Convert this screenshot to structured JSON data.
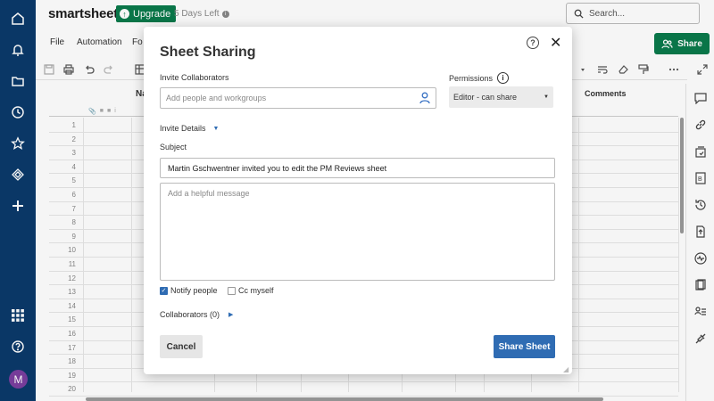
{
  "header": {
    "logo": "smartsheet",
    "upgrade_label": "Upgrade",
    "days_left": "5 Days Left",
    "search_placeholder": "Search..."
  },
  "menu": {
    "items": [
      "File",
      "Automation",
      "Fo"
    ],
    "share_label": "Share"
  },
  "grid": {
    "column_name_header": "Na",
    "comments_header": "Comments",
    "row_numbers": [
      "1",
      "2",
      "3",
      "4",
      "5",
      "6",
      "7",
      "8",
      "9",
      "10",
      "11",
      "12",
      "13",
      "14",
      "15",
      "16",
      "17",
      "18",
      "19",
      "20"
    ]
  },
  "dialog": {
    "title": "Sheet Sharing",
    "invite_label": "Invite Collaborators",
    "invite_placeholder": "Add people and workgroups",
    "permissions_label": "Permissions",
    "permission_value": "Editor - can share",
    "invite_details_label": "Invite Details",
    "subject_label": "Subject",
    "subject_value": "Martin Gschwentner invited you to edit the PM Reviews sheet",
    "message_placeholder": "Add a helpful message",
    "notify_label": "Notify people",
    "notify_checked": true,
    "cc_label": "Cc myself",
    "cc_checked": false,
    "collaborators_label": "Collaborators (0)",
    "cancel_label": "Cancel",
    "share_label": "Share Sheet"
  },
  "user": {
    "avatar_initial": "M"
  },
  "colors": {
    "nav_bg": "#0b3a6b",
    "brand_green": "#0a7a4b",
    "primary_blue": "#2f6cb3",
    "avatar_purple": "#7b3fa0"
  }
}
